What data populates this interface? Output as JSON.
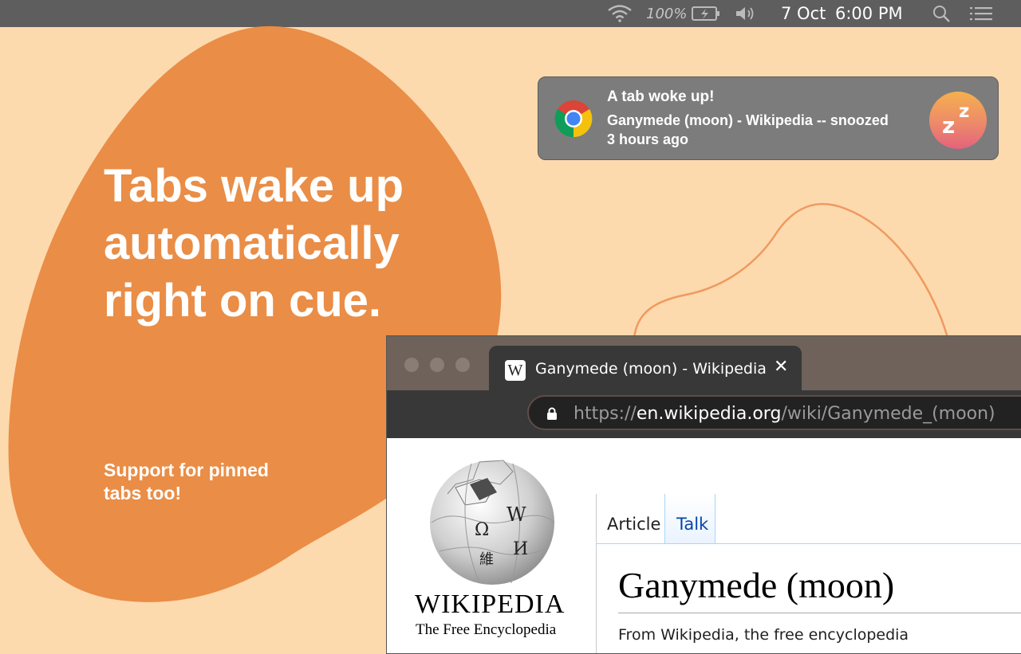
{
  "colors": {
    "background": "#fdd9ae",
    "blob": "#ea8d46",
    "menubar": "#5e5e5e",
    "notification": "#7c7c7c",
    "browser_titlebar": "#6e625a",
    "browser_toolbar": "#383838",
    "link": "#0645ad"
  },
  "menubar": {
    "battery_percent": "100%",
    "date": "7 Oct",
    "time": "6:00 PM",
    "icons": [
      "wifi-icon",
      "battery-icon",
      "volume-icon",
      "search-icon",
      "list-icon"
    ]
  },
  "headline": {
    "line1": "Tabs wake up",
    "line2": "automatically",
    "line3": "right on cue."
  },
  "subtext": {
    "line1": "Support for pinned",
    "line2": "tabs too!"
  },
  "notification": {
    "title": "A tab woke up!",
    "body": "Ganymede (moon) - Wikipedia -- snoozed",
    "time": "3 hours ago",
    "app_icon": "chrome-icon",
    "extension_icon": "snooze-icon",
    "extension_glyph_1": "z",
    "extension_glyph_2": "z"
  },
  "browser": {
    "tab": {
      "favicon_letter": "W",
      "title": "Ganymede (moon) - Wikipedia",
      "close": "✕"
    },
    "address": {
      "scheme": "https://",
      "host": "en.wikipedia.org",
      "path": "/wiki/Ganymede_(moon)"
    }
  },
  "page": {
    "wordmark": "WIKIPEDIA",
    "tagline": "The Free Encyclopedia",
    "tabs": [
      {
        "label": "Article"
      },
      {
        "label": "Talk"
      }
    ],
    "title": "Ganymede (moon)",
    "from": "From Wikipedia, the free encyclopedia"
  }
}
